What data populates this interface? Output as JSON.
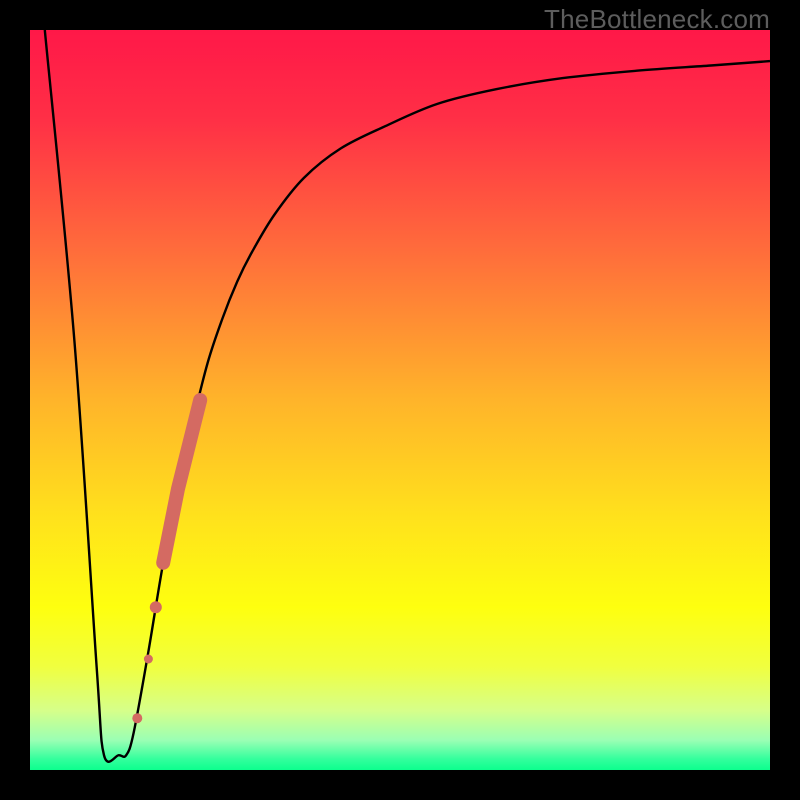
{
  "watermark": "TheBottleneck.com",
  "colors": {
    "frame": "#000000",
    "curve": "#000000",
    "dots": "#d46a62",
    "gradient_stops": [
      {
        "offset": 0.0,
        "color": "#ff1848"
      },
      {
        "offset": 0.12,
        "color": "#ff2f46"
      },
      {
        "offset": 0.3,
        "color": "#ff6d3b"
      },
      {
        "offset": 0.5,
        "color": "#ffb42a"
      },
      {
        "offset": 0.66,
        "color": "#ffe21c"
      },
      {
        "offset": 0.78,
        "color": "#feff0f"
      },
      {
        "offset": 0.86,
        "color": "#f0ff3f"
      },
      {
        "offset": 0.92,
        "color": "#d6ff8a"
      },
      {
        "offset": 0.96,
        "color": "#9affb4"
      },
      {
        "offset": 0.985,
        "color": "#34ff9d"
      },
      {
        "offset": 1.0,
        "color": "#0cff8e"
      }
    ]
  },
  "chart_data": {
    "type": "line",
    "title": "",
    "xlabel": "",
    "ylabel": "",
    "xlim": [
      0,
      100
    ],
    "ylim": [
      0,
      100
    ],
    "series": [
      {
        "name": "bottleneck-curve",
        "x": [
          2,
          6,
          9,
          10,
          12,
          13,
          14,
          16,
          18,
          20,
          22,
          24,
          26,
          28,
          30,
          33,
          37,
          42,
          48,
          55,
          63,
          72,
          82,
          92,
          100
        ],
        "y": [
          100,
          58,
          14,
          2,
          2,
          2,
          5,
          16,
          28,
          38,
          47,
          55,
          61,
          66,
          70,
          75,
          80,
          84,
          87,
          90,
          92,
          93.5,
          94.5,
          95.2,
          95.8
        ]
      }
    ],
    "annotations": {
      "dot_cluster": {
        "description": "highlighted points along rising branch",
        "points": [
          {
            "x": 14.5,
            "y": 7
          },
          {
            "x": 16.0,
            "y": 15
          },
          {
            "x": 17.0,
            "y": 22
          },
          {
            "x": 18.0,
            "y": 28
          },
          {
            "x": 19.0,
            "y": 33
          },
          {
            "x": 20.0,
            "y": 38
          },
          {
            "x": 21.0,
            "y": 42
          },
          {
            "x": 22.0,
            "y": 46
          },
          {
            "x": 23.0,
            "y": 50
          }
        ]
      }
    }
  }
}
